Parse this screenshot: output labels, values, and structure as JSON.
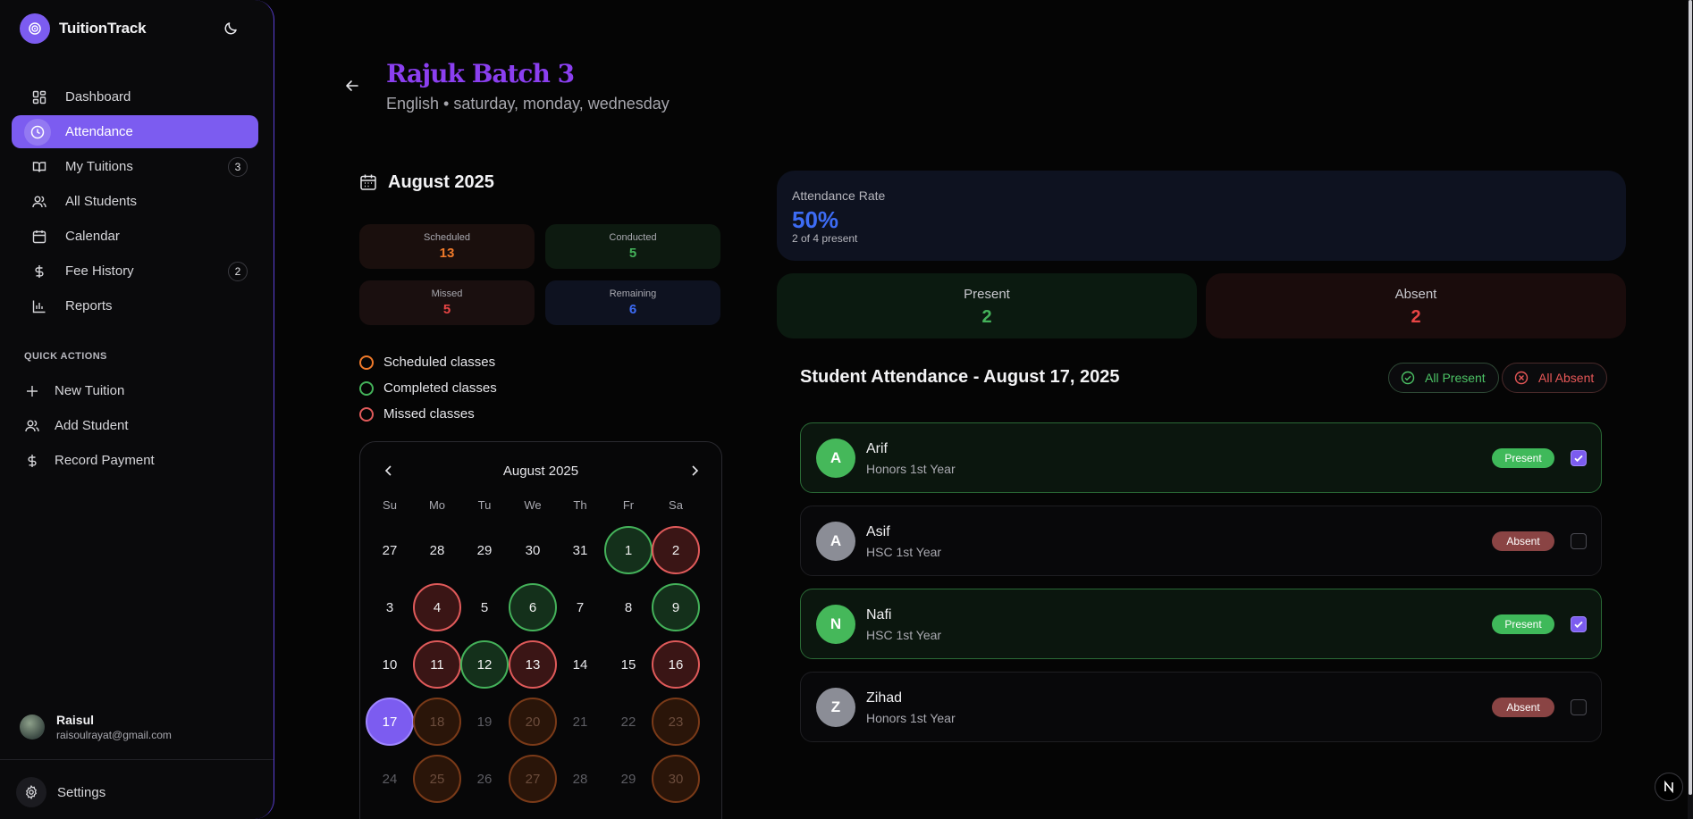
{
  "app": {
    "name": "TuitionTrack"
  },
  "sidebar": {
    "items": [
      {
        "label": "Dashboard",
        "icon": "dashboard-icon"
      },
      {
        "label": "Attendance",
        "icon": "clock-icon",
        "active": true
      },
      {
        "label": "My Tuitions",
        "icon": "book-icon",
        "badge": "3"
      },
      {
        "label": "All Students",
        "icon": "users-icon"
      },
      {
        "label": "Calendar",
        "icon": "calendar-icon"
      },
      {
        "label": "Fee History",
        "icon": "dollar-icon",
        "badge": "2"
      },
      {
        "label": "Reports",
        "icon": "bar-chart-icon"
      }
    ],
    "quick_actions_title": "QUICK ACTIONS",
    "quick_actions": [
      {
        "label": "New Tuition",
        "icon": "plus-icon"
      },
      {
        "label": "Add Student",
        "icon": "user-plus-icon"
      },
      {
        "label": "Record Payment",
        "icon": "dollar-icon"
      }
    ],
    "user": {
      "name": "Raisul",
      "email": "raisoulrayat@gmail.com"
    },
    "settings_label": "Settings"
  },
  "header": {
    "title": "Rajuk Batch 3",
    "subtitle": "English • saturday, monday, wednesday"
  },
  "month_summary": {
    "title": "August 2025",
    "scheduled": {
      "label": "Scheduled",
      "value": "13"
    },
    "conducted": {
      "label": "Conducted",
      "value": "5"
    },
    "missed": {
      "label": "Missed",
      "value": "5"
    },
    "remaining": {
      "label": "Remaining",
      "value": "6"
    }
  },
  "legend": [
    {
      "label": "Scheduled classes",
      "color": "#f07a2a"
    },
    {
      "label": "Completed classes",
      "color": "#44b25a"
    },
    {
      "label": "Missed classes",
      "color": "#e05a5a"
    }
  ],
  "calendar": {
    "title": "August 2025",
    "weekdays": [
      "Su",
      "Mo",
      "Tu",
      "We",
      "Th",
      "Fr",
      "Sa"
    ],
    "weeks": [
      [
        {
          "d": "27",
          "s": "plain"
        },
        {
          "d": "28",
          "s": "plain"
        },
        {
          "d": "29",
          "s": "plain"
        },
        {
          "d": "30",
          "s": "plain"
        },
        {
          "d": "31",
          "s": "plain"
        },
        {
          "d": "1",
          "s": "done"
        },
        {
          "d": "2",
          "s": "miss"
        }
      ],
      [
        {
          "d": "3",
          "s": "plain"
        },
        {
          "d": "4",
          "s": "miss"
        },
        {
          "d": "5",
          "s": "plain"
        },
        {
          "d": "6",
          "s": "done"
        },
        {
          "d": "7",
          "s": "plain"
        },
        {
          "d": "8",
          "s": "plain"
        },
        {
          "d": "9",
          "s": "done"
        }
      ],
      [
        {
          "d": "10",
          "s": "plain"
        },
        {
          "d": "11",
          "s": "miss"
        },
        {
          "d": "12",
          "s": "done"
        },
        {
          "d": "13",
          "s": "miss"
        },
        {
          "d": "14",
          "s": "plain"
        },
        {
          "d": "15",
          "s": "plain"
        },
        {
          "d": "16",
          "s": "miss"
        }
      ],
      [
        {
          "d": "17",
          "s": "today"
        },
        {
          "d": "18",
          "s": "sched"
        },
        {
          "d": "19",
          "s": "muted"
        },
        {
          "d": "20",
          "s": "sched"
        },
        {
          "d": "21",
          "s": "muted"
        },
        {
          "d": "22",
          "s": "muted"
        },
        {
          "d": "23",
          "s": "sched"
        }
      ],
      [
        {
          "d": "24",
          "s": "muted"
        },
        {
          "d": "25",
          "s": "sched"
        },
        {
          "d": "26",
          "s": "muted"
        },
        {
          "d": "27",
          "s": "sched"
        },
        {
          "d": "28",
          "s": "muted"
        },
        {
          "d": "29",
          "s": "muted"
        },
        {
          "d": "30",
          "s": "sched"
        }
      ]
    ]
  },
  "rate": {
    "label": "Attendance Rate",
    "value": "50%",
    "sub": "2 of 4 present"
  },
  "present_card": {
    "label": "Present",
    "value": "2"
  },
  "absent_card": {
    "label": "Absent",
    "value": "2"
  },
  "student_attendance": {
    "title": "Student Attendance - August 17, 2025",
    "all_present_label": "All Present",
    "all_absent_label": "All Absent",
    "students": [
      {
        "initial": "A",
        "name": "Arif",
        "grade": "Honors 1st Year",
        "status": "Present",
        "checked": true
      },
      {
        "initial": "A",
        "name": "Asif",
        "grade": "HSC 1st Year",
        "status": "Absent",
        "checked": false
      },
      {
        "initial": "N",
        "name": "Nafi",
        "grade": "HSC 1st Year",
        "status": "Present",
        "checked": true
      },
      {
        "initial": "Z",
        "name": "Zihad",
        "grade": "Honors 1st Year",
        "status": "Absent",
        "checked": false
      }
    ]
  },
  "colors": {
    "accent": "#7c5cf0",
    "title": "#8b3ff0",
    "scheduled": "#f07a2a",
    "conducted": "#44b25a",
    "missed": "#e84545",
    "remaining": "#3d6cf5"
  }
}
